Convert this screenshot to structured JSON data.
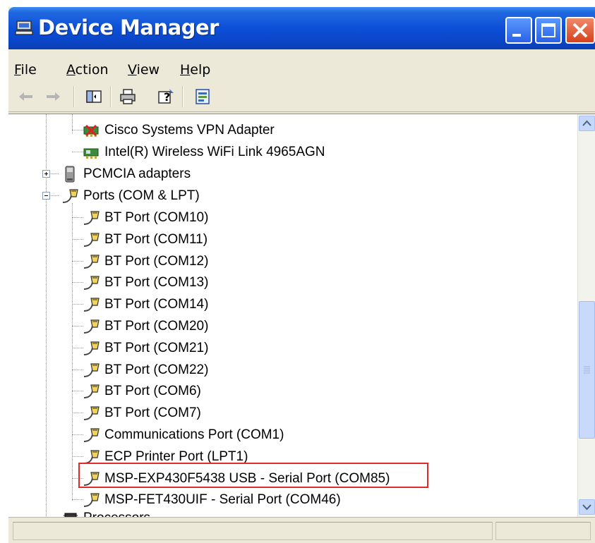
{
  "window": {
    "title": "Device Manager",
    "title_icon": "device-manager-icon",
    "controls": [
      "minimize-icon",
      "maximize-icon",
      "close-icon"
    ]
  },
  "menu": [
    {
      "label": "File",
      "underline": "F",
      "rest": "ile"
    },
    {
      "label": "Action",
      "underline": "A",
      "rest": "ction"
    },
    {
      "label": "View",
      "underline": "V",
      "rest": "iew"
    },
    {
      "label": "Help",
      "underline": "H",
      "rest": "elp"
    }
  ],
  "toolbar": [
    "back-arrow-icon",
    "forward-arrow-icon",
    "show-hide-console-tree-icon",
    "print-icon",
    "help-icon",
    "properties-icon"
  ],
  "tree": {
    "network_adapters": [
      {
        "label": "Cisco Systems VPN Adapter",
        "icon": "network-adapter-disabled-icon"
      },
      {
        "label": "Intel(R) Wireless WiFi Link 4965AGN",
        "icon": "network-adapter-icon"
      }
    ],
    "pcmcia": {
      "label": "PCMCIA adapters",
      "icon": "pcmcia-icon",
      "expanded": false
    },
    "ports": {
      "label": "Ports (COM & LPT)",
      "icon": "port-icon",
      "expanded": true,
      "children": [
        "BT Port (COM10)",
        "BT Port (COM11)",
        "BT Port (COM12)",
        "BT Port (COM13)",
        "BT Port (COM14)",
        "BT Port (COM20)",
        "BT Port (COM21)",
        "BT Port (COM22)",
        "BT Port (COM6)",
        "BT Port (COM7)",
        "Communications Port (COM1)",
        "ECP Printer Port (LPT1)",
        "MSP-EXP430F5438 USB - Serial Port (COM85)",
        "MSP-FET430UIF - Serial Port (COM46)"
      ],
      "highlighted": "MSP-EXP430F5438 USB - Serial Port (COM85)"
    },
    "processors": {
      "label": "Processors",
      "icon": "processor-icon",
      "expanded": false
    }
  },
  "colors": {
    "titlebar": "#0a46c8",
    "highlight_border": "#e22a2a",
    "window_bg": "#ece9d8"
  }
}
